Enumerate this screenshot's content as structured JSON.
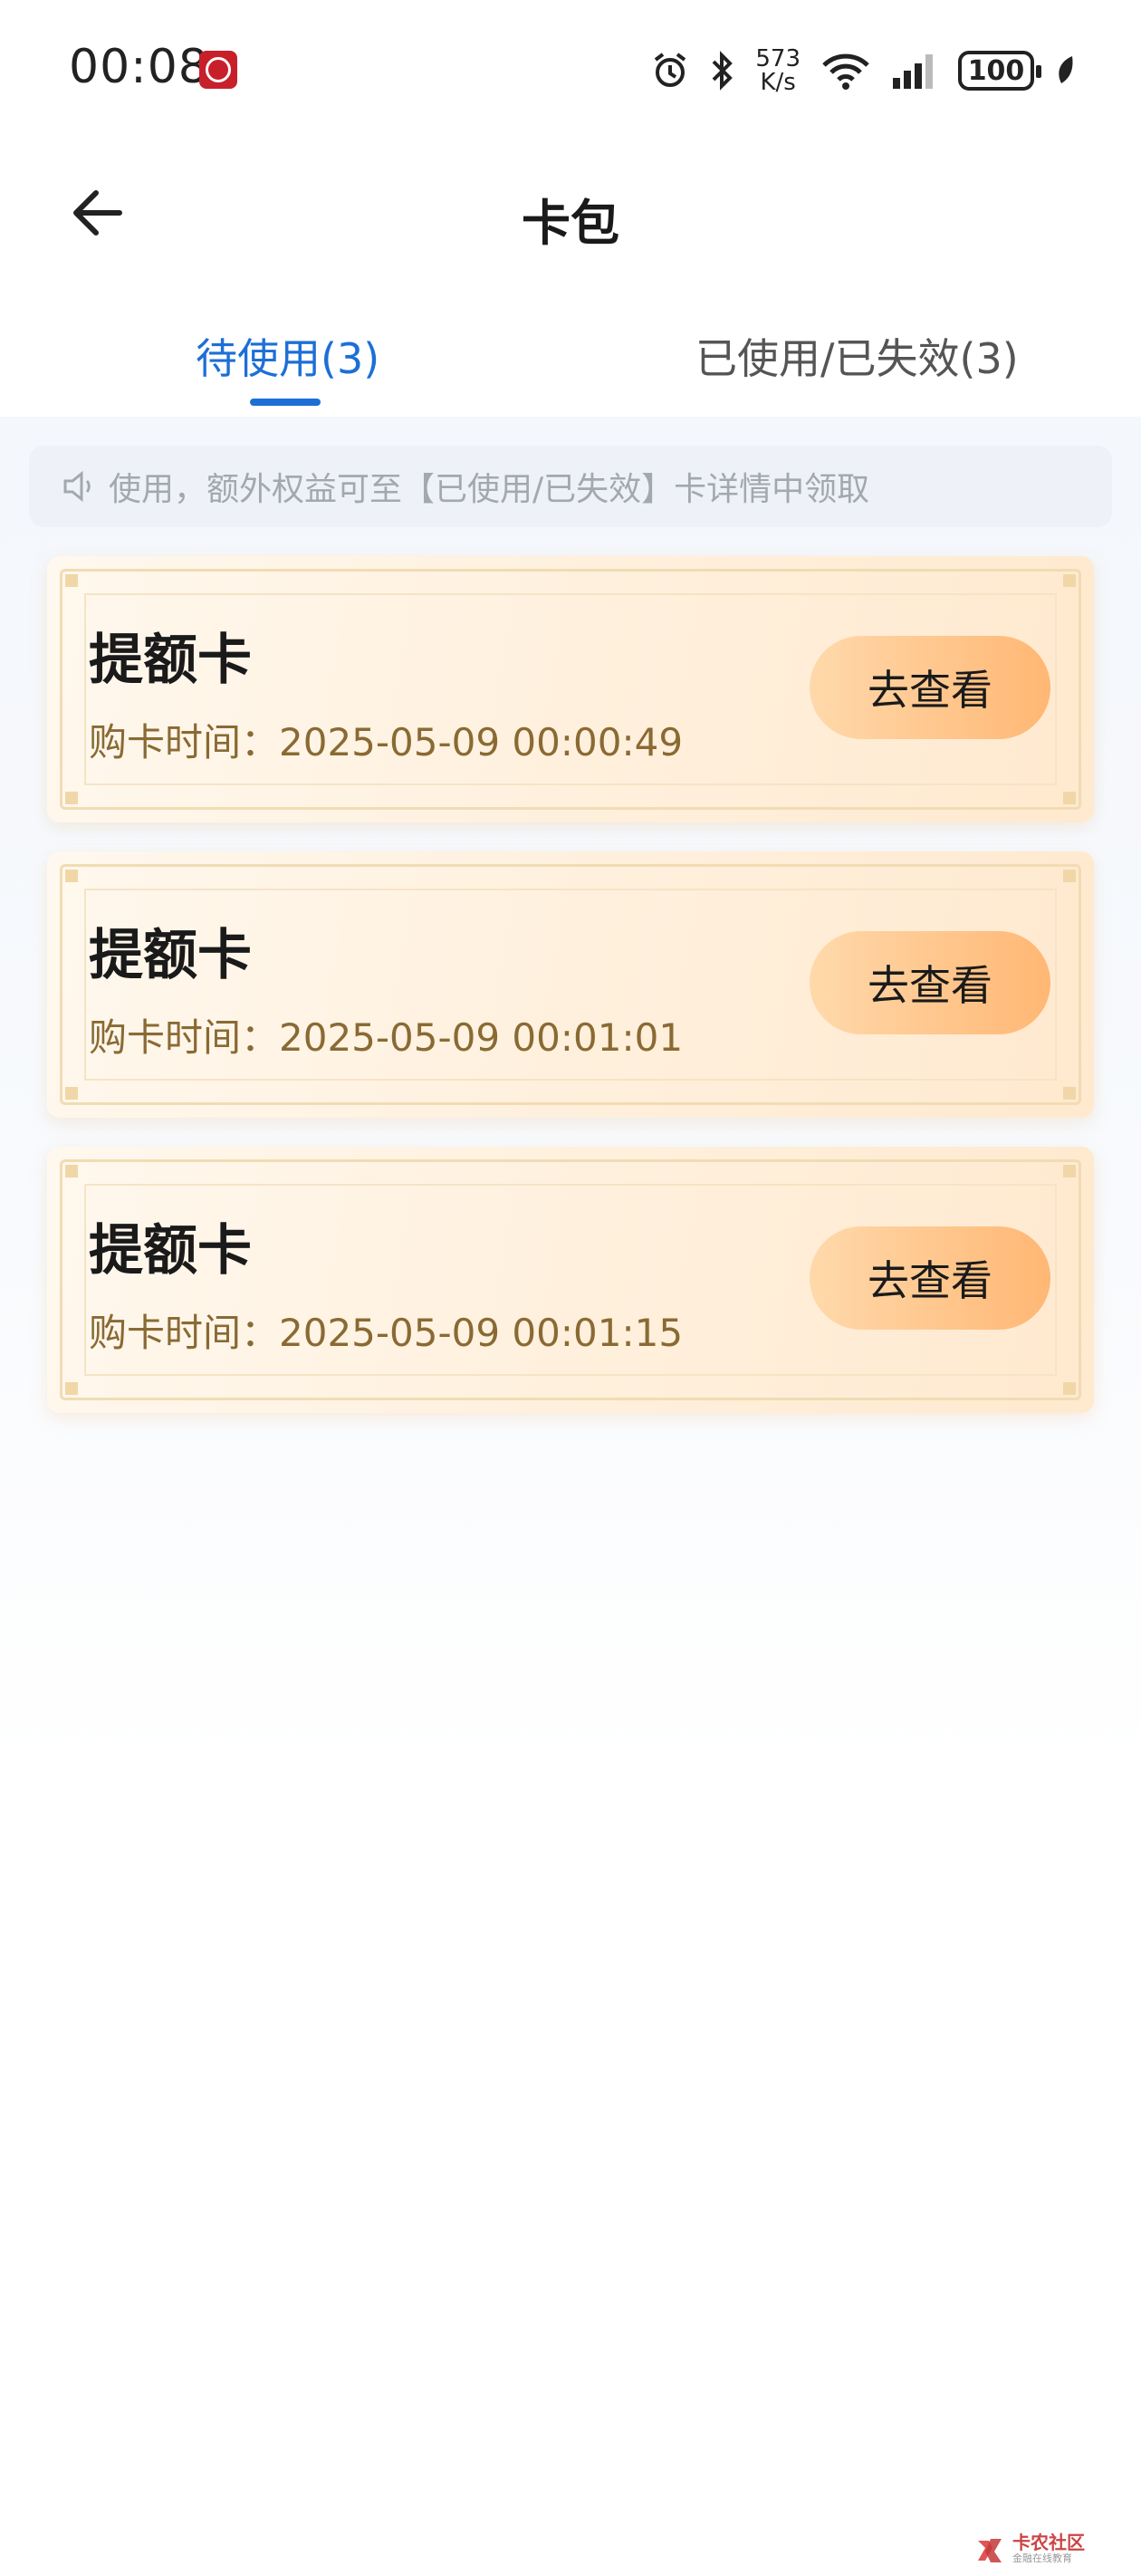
{
  "status_bar": {
    "time": "00:08",
    "speed_value": "573",
    "speed_unit": "K/s",
    "battery": "100"
  },
  "header": {
    "title": "卡包"
  },
  "tabs": [
    {
      "label": "待使用(3)",
      "active": true
    },
    {
      "label": "已使用/已失效(3)",
      "active": false
    }
  ],
  "notice": {
    "text": "使用，额外权益可至【已使用/已失效】卡详情中领取"
  },
  "cards": [
    {
      "title": "提额卡",
      "time": "购卡时间：2025-05-09 00:00:49",
      "button": "去查看"
    },
    {
      "title": "提额卡",
      "time": "购卡时间：2025-05-09 00:01:01",
      "button": "去查看"
    },
    {
      "title": "提额卡",
      "time": "购卡时间：2025-05-09 00:01:15",
      "button": "去查看"
    }
  ],
  "watermark": {
    "title": "卡农社区",
    "subtitle": "金融在线教育"
  },
  "colors": {
    "accent": "#1d6fd6",
    "button_start": "#ffd9ab",
    "button_end": "#ffb774",
    "time_text": "#8a6a33"
  }
}
